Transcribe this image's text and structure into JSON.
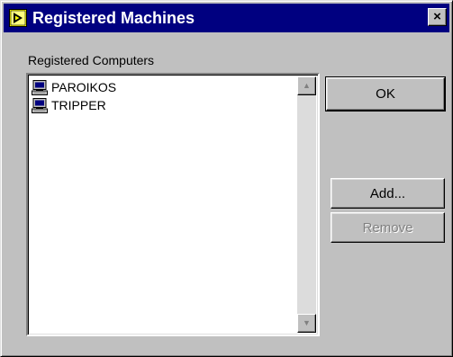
{
  "window": {
    "title": "Registered Machines",
    "close_glyph": "×"
  },
  "list": {
    "label": "Registered Computers",
    "items": [
      {
        "name": "PAROIKOS",
        "icon": "computer-icon"
      },
      {
        "name": "TRIPPER",
        "icon": "computer-icon"
      }
    ]
  },
  "buttons": {
    "ok": "OK",
    "add": "Add...",
    "remove": "Remove"
  },
  "colors": {
    "titlebar": "#000080",
    "face": "#c0c0c0",
    "disabled_text": "#808080"
  }
}
